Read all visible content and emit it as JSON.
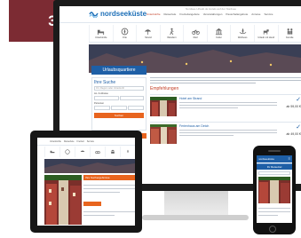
{
  "badge": {
    "step": "3"
  },
  "desktop": {
    "logo_text": "nordseeküste",
    "top_links": "Nordsee-Urlaub.de   Hotels auf der Nordsee",
    "nav": [
      "Unterkünfte",
      "Reiseziele",
      "Freizeitangebote",
      "Veranstaltungen",
      "Pauschalangebote",
      "Anreise",
      "Service"
    ],
    "icon_items": [
      {
        "label": "Unterkünfte",
        "icon": "bed-icon"
      },
      {
        "label": "Orte",
        "icon": "compass-icon"
      },
      {
        "label": "Strand",
        "icon": "umbrella-icon"
      },
      {
        "label": "Wandern",
        "icon": "hiker-icon"
      },
      {
        "label": "Rad",
        "icon": "bicycle-icon"
      },
      {
        "label": "Kultur",
        "icon": "temple-icon"
      },
      {
        "label": "Wellness",
        "icon": "spa-icon"
      },
      {
        "label": "Urlaub mit Hund",
        "icon": "dog-icon"
      },
      {
        "label": "Familie",
        "icon": "family-icon"
      }
    ],
    "hero_title": "Urlaubsquartiere",
    "search": {
      "title": "Ihre Suche",
      "placeholder": "Ort, Region oder Unterkunft",
      "label_dates": "An- & Abreise",
      "label_persons": "Personen",
      "button": "Suchen"
    },
    "side_button": "Unterkunft buchen",
    "subtitle": "Empfehlungen",
    "cards": [
      {
        "heading": "Hotel am Strand",
        "price": "ab 59,00 €"
      },
      {
        "heading": "Ferienhaus am Deich",
        "price": "ab 49,00 €"
      }
    ]
  },
  "tablet": {
    "nav": [
      "Unterkünfte",
      "Reiseziele",
      "Freizeit",
      "Service"
    ],
    "result_bar": "Ihre Suchergebnisse"
  },
  "phone": {
    "logo_text": "nordseeküste",
    "menu_symbol": "≡",
    "title": "Ihr Reiseziel"
  },
  "colors": {
    "badge": "#7c2b33",
    "brand_blue": "#1e5fa6",
    "accent_orange": "#e8641e",
    "device_black": "#1b1b1b"
  }
}
